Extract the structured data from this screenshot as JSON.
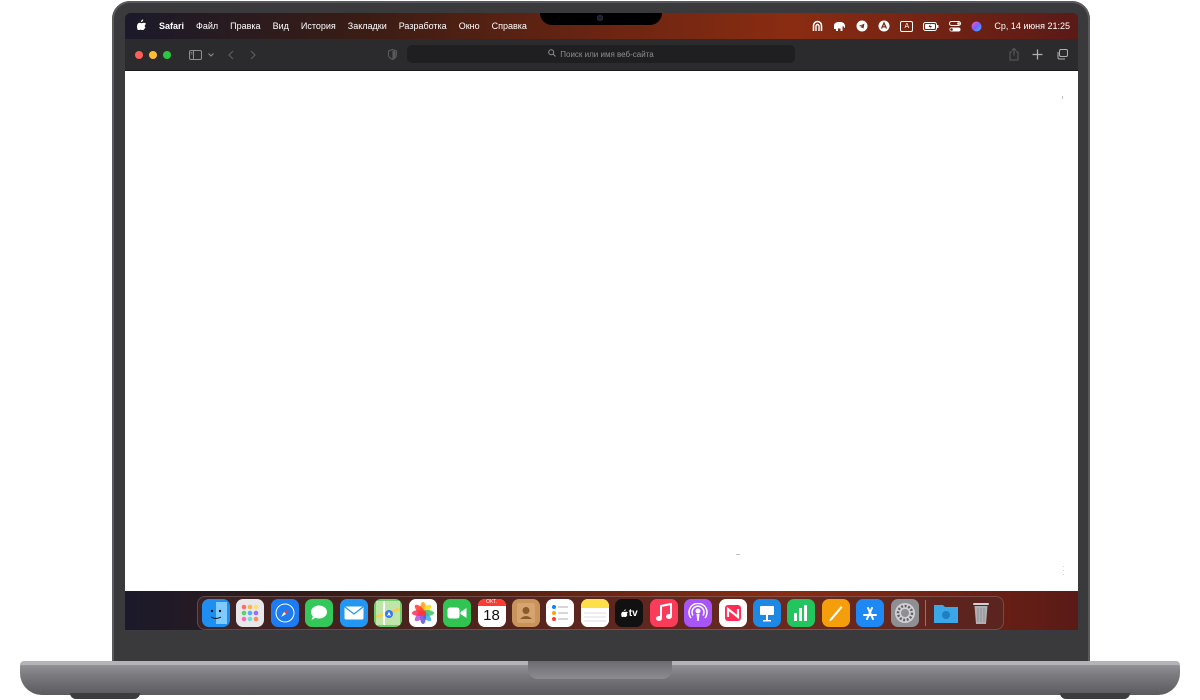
{
  "menubar": {
    "app_name": "Safari",
    "items": [
      "Файл",
      "Правка",
      "Вид",
      "История",
      "Закладки",
      "Разработка",
      "Окно",
      "Справка"
    ],
    "clock": "Ср, 14 июня  21:25",
    "keyboard_layout": "A"
  },
  "toolbar": {
    "address_placeholder": "Поиск или имя веб-сайта"
  },
  "dock": {
    "apps": [
      {
        "name": "finder",
        "color": "#1e8ff0"
      },
      {
        "name": "launchpad",
        "color": "#e8e8ea"
      },
      {
        "name": "safari",
        "color": "#1d7cf2"
      },
      {
        "name": "messages",
        "color": "#34c759"
      },
      {
        "name": "mail",
        "color": "#2196f3"
      },
      {
        "name": "maps",
        "color": "#6bcf6b"
      },
      {
        "name": "photos",
        "color": "#ffffff"
      },
      {
        "name": "facetime",
        "color": "#30c453"
      },
      {
        "name": "calendar",
        "color": "#ffffff",
        "month": "ОКТ.",
        "day": "18"
      },
      {
        "name": "contacts",
        "color": "#c9935b"
      },
      {
        "name": "reminders",
        "color": "#ffffff"
      },
      {
        "name": "notes",
        "color": "#fde047"
      },
      {
        "name": "tv",
        "color": "#111111",
        "label": "tv"
      },
      {
        "name": "music",
        "color": "#fa3c5a"
      },
      {
        "name": "podcasts",
        "color": "#a855f7"
      },
      {
        "name": "news",
        "color": "#ffffff"
      },
      {
        "name": "keynote",
        "color": "#1e88e5"
      },
      {
        "name": "numbers",
        "color": "#22c55e"
      },
      {
        "name": "pages",
        "color": "#f59e0b"
      },
      {
        "name": "app-store",
        "color": "#1e88f5"
      },
      {
        "name": "system-settings",
        "color": "#8e8e93"
      }
    ],
    "extras": [
      {
        "name": "downloads-folder",
        "color": "#3aa8e8"
      },
      {
        "name": "trash",
        "color": "#9a9a9e"
      }
    ]
  }
}
